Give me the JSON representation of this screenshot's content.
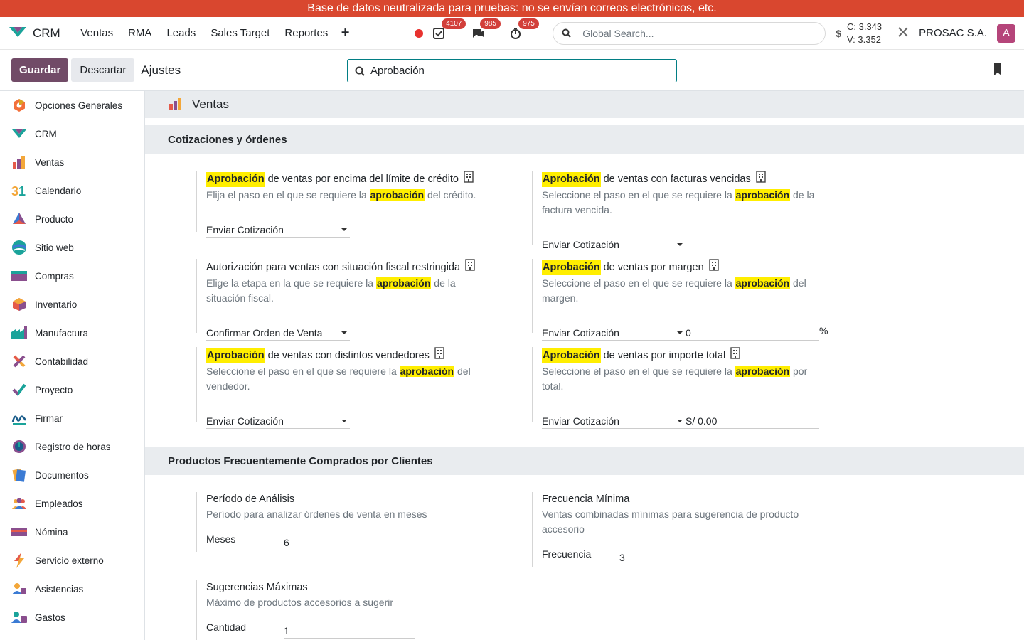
{
  "banner": "Base de datos neutralizada para pruebas: no se envían correos electrónicos, etc.",
  "navbar": {
    "app_name": "CRM",
    "menu": [
      "Ventas",
      "RMA",
      "Leads",
      "Sales Target",
      "Reportes"
    ],
    "activity_badge": "4107",
    "messages_badge": "985",
    "timer_badge": "975",
    "search_placeholder": "Global Search...",
    "rate_c": "C: 3.343",
    "rate_v": "V: 3.352",
    "company": "PROSAC S.A.",
    "avatar": "A"
  },
  "control": {
    "save": "Guardar",
    "discard": "Descartar",
    "title": "Ajustes",
    "search_value": "Aprobación"
  },
  "sidebar": {
    "items": [
      {
        "label": "Opciones Generales",
        "icon": "settings-icon"
      },
      {
        "label": "CRM",
        "icon": "crm-icon"
      },
      {
        "label": "Ventas",
        "icon": "sales-icon"
      },
      {
        "label": "Calendario",
        "icon": "calendar-icon"
      },
      {
        "label": "Producto",
        "icon": "product-icon"
      },
      {
        "label": "Sitio web",
        "icon": "website-icon"
      },
      {
        "label": "Compras",
        "icon": "purchase-icon"
      },
      {
        "label": "Inventario",
        "icon": "inventory-icon"
      },
      {
        "label": "Manufactura",
        "icon": "manufacturing-icon"
      },
      {
        "label": "Contabilidad",
        "icon": "accounting-icon"
      },
      {
        "label": "Proyecto",
        "icon": "project-icon"
      },
      {
        "label": "Firmar",
        "icon": "sign-icon"
      },
      {
        "label": "Registro de horas",
        "icon": "timesheet-icon"
      },
      {
        "label": "Documentos",
        "icon": "documents-icon"
      },
      {
        "label": "Empleados",
        "icon": "employees-icon"
      },
      {
        "label": "Nómina",
        "icon": "payroll-icon"
      },
      {
        "label": "Servicio externo",
        "icon": "field-service-icon"
      },
      {
        "label": "Asistencias",
        "icon": "attendance-icon"
      },
      {
        "label": "Gastos",
        "icon": "expenses-icon"
      }
    ]
  },
  "app_section": "Ventas",
  "sections": {
    "quotes": "Cotizaciones y órdenes",
    "frequent": "Productos Frecuentemente Comprados por Clientes"
  },
  "settings": {
    "credit": {
      "hl": "Aprobación",
      "title_rest": " de ventas por encima del límite de crédito",
      "desc_a": "Elija el paso en el que se requiere la ",
      "desc_hl": "aprobación",
      "desc_b": " del crédito.",
      "value": "Enviar Cotización"
    },
    "overdue": {
      "hl": "Aprobación",
      "title_rest": " de ventas con facturas vencidas",
      "desc_a": "Seleccione el paso en el que se requiere la ",
      "desc_hl": "aprobación",
      "desc_b": " de la factura vencida.",
      "value": "Enviar Cotización"
    },
    "fiscal": {
      "title": "Autorización para ventas con situación fiscal restringida",
      "desc_a": "Elige la etapa en la que se requiere la ",
      "desc_hl": "aprobación",
      "desc_b": " de la situación fiscal.",
      "value": "Confirmar Orden de Venta"
    },
    "margin": {
      "hl": "Aprobación",
      "title_rest": " de ventas por margen",
      "desc_a": "Seleccione el paso en el que se requiere la ",
      "desc_hl": "aprobación",
      "desc_b": " del margen.",
      "value": "Enviar Cotización",
      "amount": "0",
      "unit": "%"
    },
    "sellers": {
      "hl": "Aprobación",
      "title_rest": " de ventas con distintos vendedores",
      "desc_a": "Seleccione el paso en el que se requiere la ",
      "desc_hl": "aprobación",
      "desc_b": " del vendedor.",
      "value": "Enviar Cotización"
    },
    "total": {
      "hl": "Aprobación",
      "title_rest": " de ventas por importe total",
      "desc_a": "Seleccione el paso en el que se requiere la ",
      "desc_hl": "aprobación",
      "desc_b": " por total.",
      "value": "Enviar Cotización",
      "amount": "S/ 0.00"
    },
    "period": {
      "title": "Período de Análisis",
      "desc": "Período para analizar órdenes de venta en meses",
      "label": "Meses",
      "value": "6"
    },
    "minfreq": {
      "title": "Frecuencia Mínima",
      "desc": "Ventas combinadas mínimas para sugerencia de producto accesorio",
      "label": "Frecuencia",
      "value": "3"
    },
    "maxsug": {
      "title": "Sugerencias Máximas",
      "desc": "Máximo de productos accesorios a sugerir",
      "label": "Cantidad",
      "value": "1"
    }
  }
}
